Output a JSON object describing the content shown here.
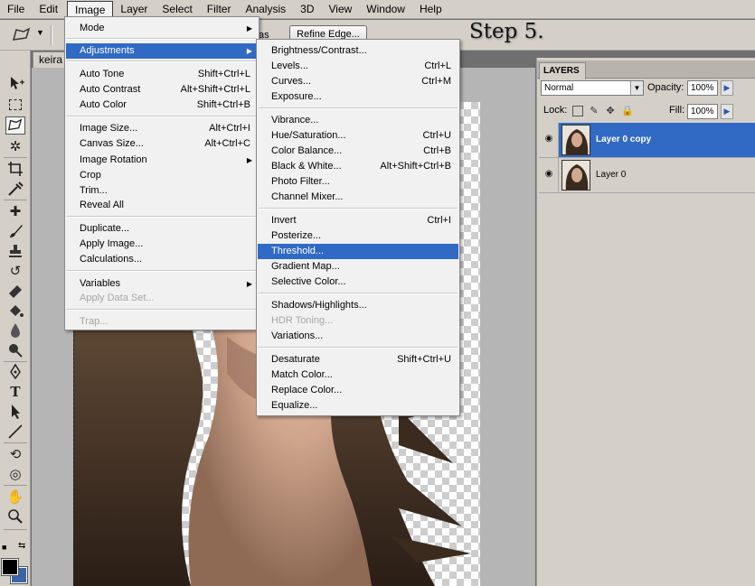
{
  "menubar": {
    "items": [
      "File",
      "Edit",
      "Image",
      "Layer",
      "Select",
      "Filter",
      "Analysis",
      "3D",
      "View",
      "Window",
      "Help"
    ],
    "active": "Image"
  },
  "options_bar": {
    "as_label": "as",
    "refine_edge": "Refine Edge..."
  },
  "step_label": "Step 5.",
  "document": {
    "tab_title": "keira"
  },
  "image_menu": {
    "items": [
      {
        "label": "Mode",
        "submenu": true
      },
      {
        "label": "Adjustments",
        "submenu": true,
        "highlighted": true
      },
      {
        "label": "Auto Tone",
        "shortcut": "Shift+Ctrl+L"
      },
      {
        "label": "Auto Contrast",
        "shortcut": "Alt+Shift+Ctrl+L"
      },
      {
        "label": "Auto Color",
        "shortcut": "Shift+Ctrl+B"
      },
      {
        "label": "Image Size...",
        "shortcut": "Alt+Ctrl+I"
      },
      {
        "label": "Canvas Size...",
        "shortcut": "Alt+Ctrl+C"
      },
      {
        "label": "Image Rotation",
        "submenu": true
      },
      {
        "label": "Crop"
      },
      {
        "label": "Trim..."
      },
      {
        "label": "Reveal All"
      },
      {
        "label": "Duplicate..."
      },
      {
        "label": "Apply Image..."
      },
      {
        "label": "Calculations..."
      },
      {
        "label": "Variables",
        "submenu": true
      },
      {
        "label": "Apply Data Set...",
        "disabled": true
      },
      {
        "label": "Trap...",
        "disabled": true
      }
    ]
  },
  "adjustments_menu": {
    "items": [
      {
        "label": "Brightness/Contrast..."
      },
      {
        "label": "Levels...",
        "shortcut": "Ctrl+L"
      },
      {
        "label": "Curves...",
        "shortcut": "Ctrl+M"
      },
      {
        "label": "Exposure..."
      },
      {
        "label": "Vibrance..."
      },
      {
        "label": "Hue/Saturation...",
        "shortcut": "Ctrl+U"
      },
      {
        "label": "Color Balance...",
        "shortcut": "Ctrl+B"
      },
      {
        "label": "Black & White...",
        "shortcut": "Alt+Shift+Ctrl+B"
      },
      {
        "label": "Photo Filter..."
      },
      {
        "label": "Channel Mixer..."
      },
      {
        "label": "Invert",
        "shortcut": "Ctrl+I"
      },
      {
        "label": "Posterize..."
      },
      {
        "label": "Threshold...",
        "highlighted": true
      },
      {
        "label": "Gradient Map..."
      },
      {
        "label": "Selective Color..."
      },
      {
        "label": "Shadows/Highlights..."
      },
      {
        "label": "HDR Toning...",
        "disabled": true
      },
      {
        "label": "Variations..."
      },
      {
        "label": "Desaturate",
        "shortcut": "Shift+Ctrl+U"
      },
      {
        "label": "Match Color..."
      },
      {
        "label": "Replace Color..."
      },
      {
        "label": "Equalize..."
      }
    ]
  },
  "layers_panel": {
    "tab": "LAYERS",
    "blend_mode": "Normal",
    "opacity_label": "Opacity:",
    "opacity": "100%",
    "lock_label": "Lock:",
    "fill_label": "Fill:",
    "fill": "100%",
    "layers": [
      {
        "name": "Layer 0 copy",
        "selected": true
      },
      {
        "name": "Layer 0",
        "selected": false
      }
    ]
  },
  "colors": {
    "highlight": "#316ac5",
    "foreground": "#000000",
    "background": "#3a66a8"
  },
  "icons": {
    "tools": [
      "move-icon",
      "marquee-icon",
      "polygonal-lasso-icon",
      "magic-wand-icon",
      "crop-icon",
      "eyedropper-icon",
      "healing-brush-icon",
      "brush-icon",
      "clone-stamp-icon",
      "history-brush-icon",
      "eraser-icon",
      "paint-bucket-icon",
      "blur-icon",
      "dodge-icon",
      "pen-icon",
      "type-icon",
      "path-selection-icon",
      "line-icon",
      "3d-rotate-icon",
      "3d-orbit-icon",
      "hand-icon",
      "zoom-icon"
    ]
  }
}
